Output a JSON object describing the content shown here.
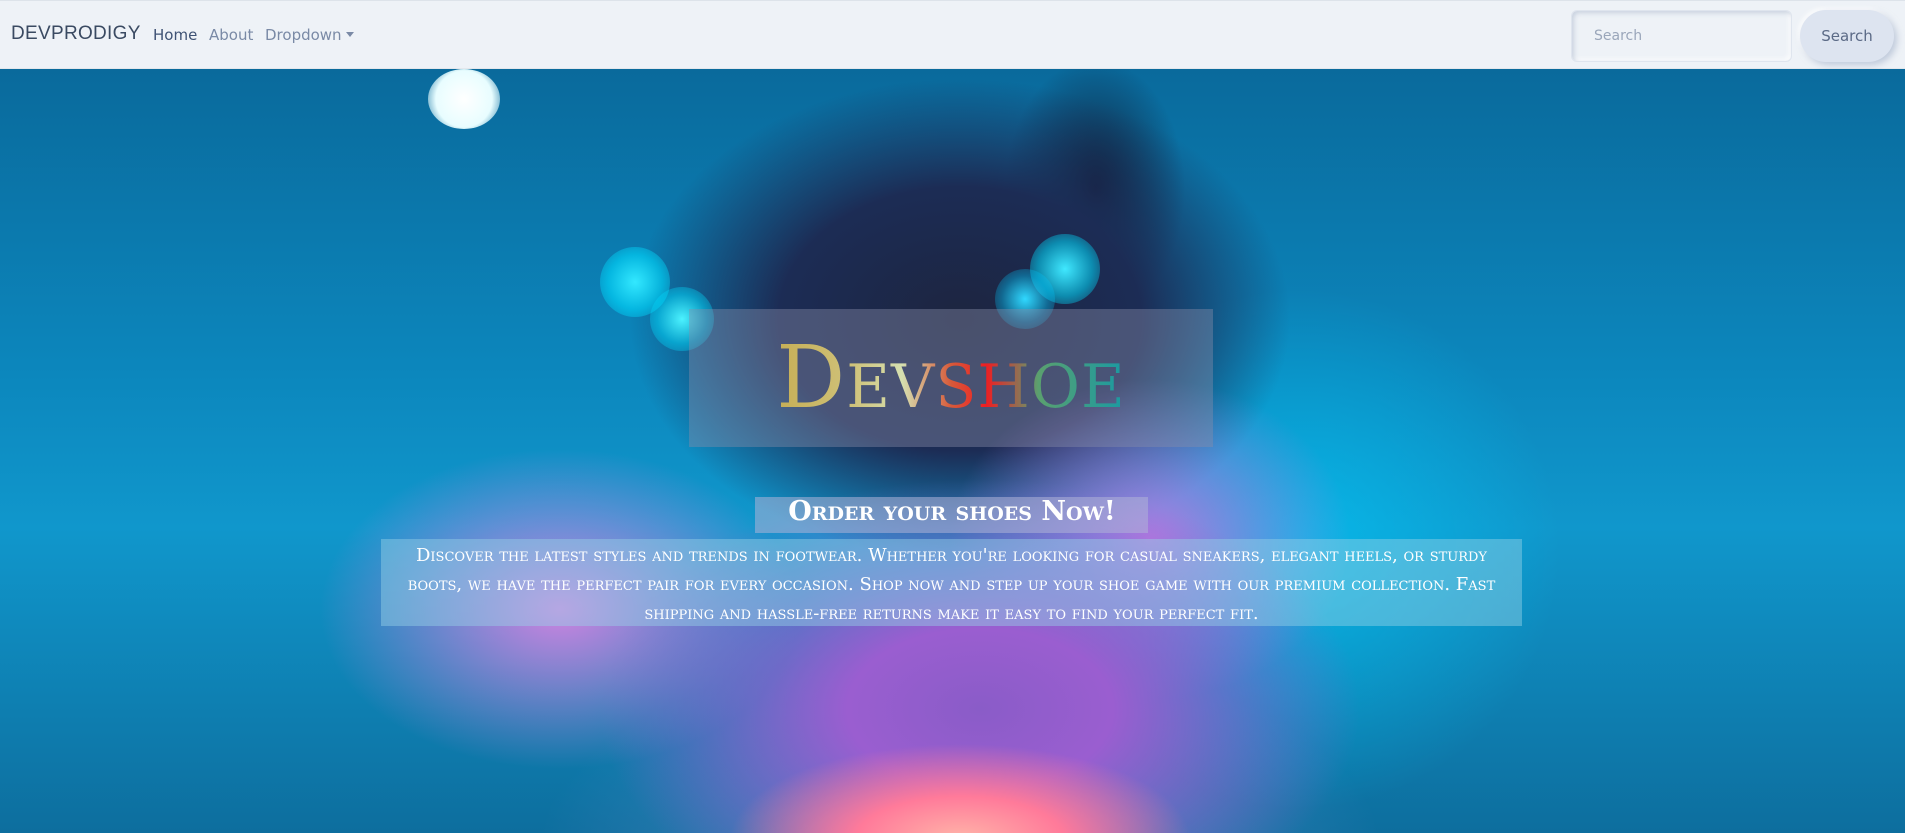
{
  "navbar": {
    "brand": "DEVPRODIGY",
    "links": [
      {
        "label": "Home",
        "active": true
      },
      {
        "label": "About",
        "active": false
      },
      {
        "label": "Dropdown",
        "active": false
      }
    ],
    "search": {
      "placeholder": "Search",
      "value": "",
      "button_label": "Search"
    }
  },
  "hero": {
    "title": "Devshoe",
    "subtitle": "Order your shoes Now!",
    "description": "Discover the latest styles and trends in footwear. Whether you're looking for casual sneakers, elegant heels, or sturdy boots, we have the perfect pair for every occasion. Shop now and step up your shoe game with our premium collection. Fast shipping and hassle-free returns make it easy to find your perfect fit."
  },
  "colors": {
    "navbar_bg": "#eef2f7",
    "brand_text": "#3a4a62",
    "link_muted": "#7a8aa6",
    "hero_blue": "#0c87bd",
    "hero_text": "#ffffff"
  }
}
